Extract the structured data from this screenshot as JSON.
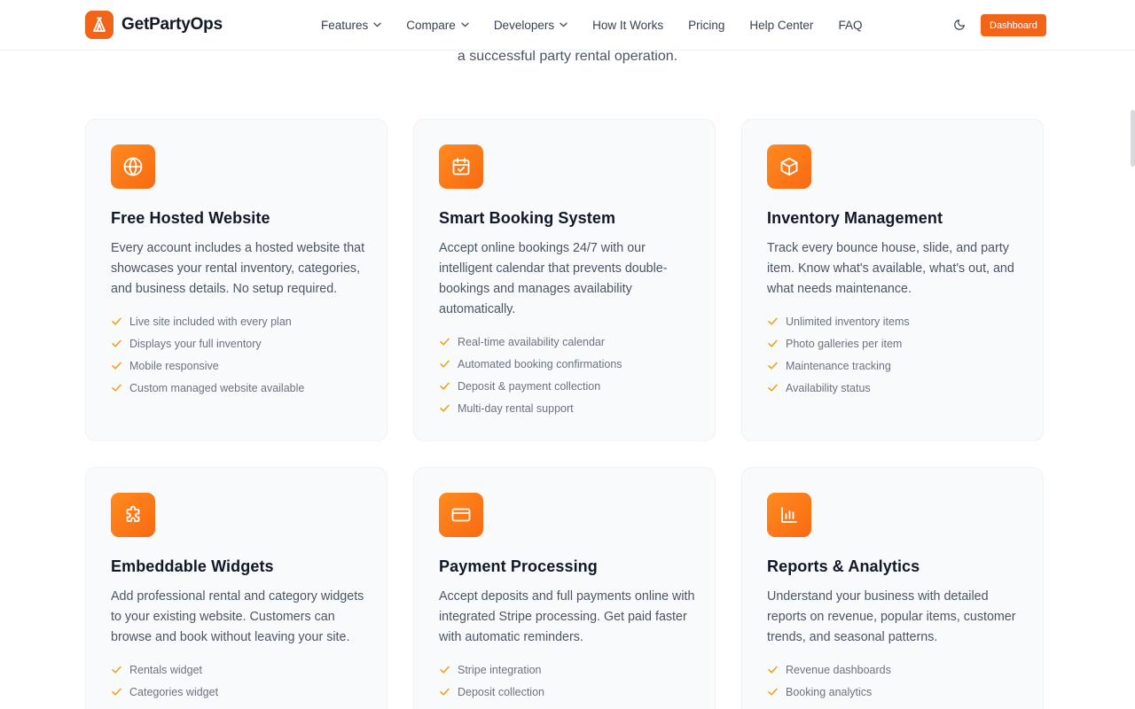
{
  "header": {
    "brand": "GetPartyOps",
    "nav": [
      {
        "label": "Features",
        "dropdown": true
      },
      {
        "label": "Compare",
        "dropdown": true
      },
      {
        "label": "Developers",
        "dropdown": true
      },
      {
        "label": "How It Works",
        "dropdown": false
      },
      {
        "label": "Pricing",
        "dropdown": false
      },
      {
        "label": "Help Center",
        "dropdown": false
      },
      {
        "label": "FAQ",
        "dropdown": false
      }
    ],
    "dashboard_label": "Dashboard"
  },
  "hero": {
    "subtitle_tail": "a successful party rental operation."
  },
  "colors": {
    "accent": "#f26418",
    "check": "#f59e0b"
  },
  "cards": [
    {
      "icon": "globe-icon",
      "title": "Free Hosted Website",
      "description": "Every account includes a hosted website that showcases your rental inventory, categories, and business details. No setup required.",
      "features": [
        "Live site included with every plan",
        "Displays your full inventory",
        "Mobile responsive",
        "Custom managed website available"
      ]
    },
    {
      "icon": "calendar-check-icon",
      "title": "Smart Booking System",
      "description": "Accept online bookings 24/7 with our intelligent calendar that prevents double-bookings and manages availability automatically.",
      "features": [
        "Real-time availability calendar",
        "Automated booking confirmations",
        "Deposit & payment collection",
        "Multi-day rental support"
      ]
    },
    {
      "icon": "box-icon",
      "title": "Inventory Management",
      "description": "Track every bounce house, slide, and party item. Know what's available, what's out, and what needs maintenance.",
      "features": [
        "Unlimited inventory items",
        "Photo galleries per item",
        "Maintenance tracking",
        "Availability status"
      ]
    },
    {
      "icon": "puzzle-icon",
      "title": "Embeddable Widgets",
      "description": "Add professional rental and category widgets to your existing website. Customers can browse and book without leaving your site.",
      "features": [
        "Rentals widget",
        "Categories widget"
      ]
    },
    {
      "icon": "credit-card-icon",
      "title": "Payment Processing",
      "description": "Accept deposits and full payments online with integrated Stripe processing. Get paid faster with automatic reminders.",
      "features": [
        "Stripe integration",
        "Deposit collection"
      ]
    },
    {
      "icon": "bar-chart-icon",
      "title": "Reports & Analytics",
      "description": "Understand your business with detailed reports on revenue, popular items, customer trends, and seasonal patterns.",
      "features": [
        "Revenue dashboards",
        "Booking analytics"
      ]
    }
  ]
}
